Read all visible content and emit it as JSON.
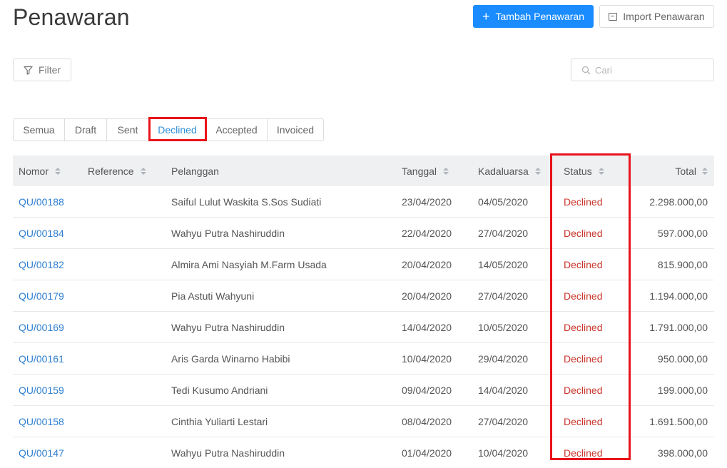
{
  "page": {
    "title": "Penawaran"
  },
  "header": {
    "add_label": "Tambah Penawaran",
    "import_label": "Import Penawaran"
  },
  "toolbar": {
    "filter_label": "Filter",
    "search_placeholder": "Cari"
  },
  "tabs": [
    {
      "label": "Semua",
      "active": false
    },
    {
      "label": "Draft",
      "active": false
    },
    {
      "label": "Sent",
      "active": false
    },
    {
      "label": "Declined",
      "active": true
    },
    {
      "label": "Accepted",
      "active": false
    },
    {
      "label": "Invoiced",
      "active": false
    }
  ],
  "table": {
    "headers": {
      "nomor": "Nomor",
      "reference": "Reference",
      "pelanggan": "Pelanggan",
      "tanggal": "Tanggal",
      "kadaluarsa": "Kadaluarsa",
      "status": "Status",
      "total": "Total"
    },
    "rows": [
      {
        "nomor": "QU/00188",
        "reference": "",
        "pelanggan": "Saiful Lulut Waskita S.Sos Sudiati",
        "tanggal": "23/04/2020",
        "kadaluarsa": "04/05/2020",
        "status": "Declined",
        "total": "2.298.000,00"
      },
      {
        "nomor": "QU/00184",
        "reference": "",
        "pelanggan": "Wahyu Putra Nashiruddin",
        "tanggal": "22/04/2020",
        "kadaluarsa": "27/04/2020",
        "status": "Declined",
        "total": "597.000,00"
      },
      {
        "nomor": "QU/00182",
        "reference": "",
        "pelanggan": "Almira Ami Nasyiah M.Farm Usada",
        "tanggal": "20/04/2020",
        "kadaluarsa": "14/05/2020",
        "status": "Declined",
        "total": "815.900,00"
      },
      {
        "nomor": "QU/00179",
        "reference": "",
        "pelanggan": "Pia Astuti Wahyuni",
        "tanggal": "20/04/2020",
        "kadaluarsa": "27/04/2020",
        "status": "Declined",
        "total": "1.194.000,00"
      },
      {
        "nomor": "QU/00169",
        "reference": "",
        "pelanggan": "Wahyu Putra Nashiruddin",
        "tanggal": "14/04/2020",
        "kadaluarsa": "10/05/2020",
        "status": "Declined",
        "total": "1.791.000,00"
      },
      {
        "nomor": "QU/00161",
        "reference": "",
        "pelanggan": "Aris Garda Winarno Habibi",
        "tanggal": "10/04/2020",
        "kadaluarsa": "29/04/2020",
        "status": "Declined",
        "total": "950.000,00"
      },
      {
        "nomor": "QU/00159",
        "reference": "",
        "pelanggan": "Tedi Kusumo Andriani",
        "tanggal": "09/04/2020",
        "kadaluarsa": "14/04/2020",
        "status": "Declined",
        "total": "199.000,00"
      },
      {
        "nomor": "QU/00158",
        "reference": "",
        "pelanggan": "Cinthia Yuliarti Lestari",
        "tanggal": "08/04/2020",
        "kadaluarsa": "27/04/2020",
        "status": "Declined",
        "total": "1.691.500,00"
      },
      {
        "nomor": "QU/00147",
        "reference": "",
        "pelanggan": "Wahyu Putra Nashiruddin",
        "tanggal": "01/04/2020",
        "kadaluarsa": "10/04/2020",
        "status": "Declined",
        "total": "398.000,00"
      }
    ]
  },
  "colors": {
    "primary": "#1a8cff",
    "link": "#2f7fd0",
    "declined": "#c8352b",
    "highlight": "#e8141b",
    "header_bg": "#eef0f2"
  },
  "icons": {
    "add": "plus-icon",
    "import": "import-icon",
    "filter": "filter-icon",
    "search": "search-icon",
    "sort": "sort-icon"
  }
}
